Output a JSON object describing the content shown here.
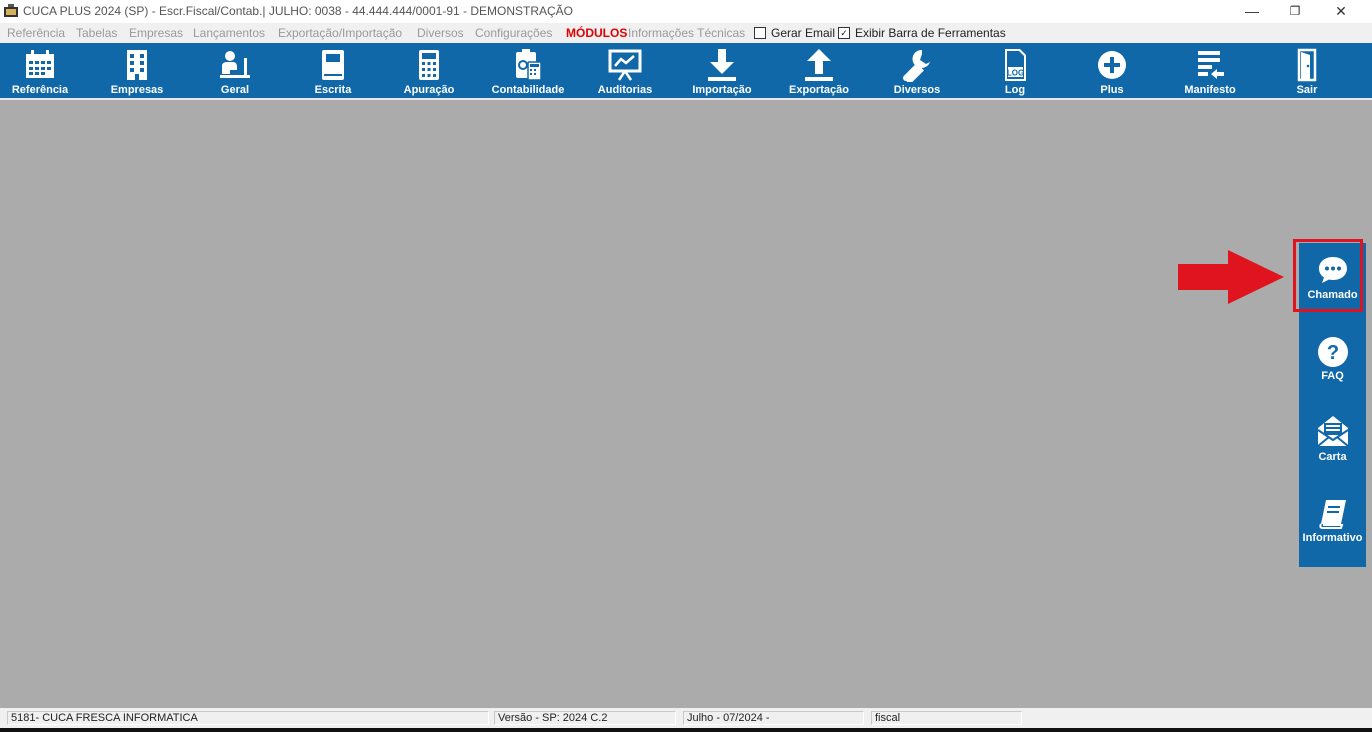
{
  "window": {
    "title": "CUCA PLUS 2024 (SP) - Escr.Fiscal/Contab.| JULHO: 0038 - 44.444.444/0001-91 - DEMONSTRAÇÃO",
    "minimize": "—",
    "restore": "❐",
    "close": "✕"
  },
  "menu": {
    "items": [
      "Referência",
      "Tabelas",
      "Empresas",
      "Lançamentos",
      "Exportação/Importação",
      "Diversos",
      "Configurações",
      "MÓDULOS",
      "Informações Técnicas"
    ],
    "gerar_email": {
      "label": "Gerar Email",
      "checked": false
    },
    "exibir_barra": {
      "label": "Exibir Barra de Ferramentas",
      "checked": true,
      "mark": "✓"
    }
  },
  "toolbar": [
    {
      "label": "Referência",
      "icon": "calendar-icon"
    },
    {
      "label": "Empresas",
      "icon": "building-icon"
    },
    {
      "label": "Geral",
      "icon": "user-desk-icon"
    },
    {
      "label": "Escrita",
      "icon": "book-icon"
    },
    {
      "label": "Apuração",
      "icon": "calculator-icon"
    },
    {
      "label": "Contabilidade",
      "icon": "accounting-icon"
    },
    {
      "label": "Auditorias",
      "icon": "chart-board-icon"
    },
    {
      "label": "Importação",
      "icon": "download-icon"
    },
    {
      "label": "Exportação",
      "icon": "upload-icon"
    },
    {
      "label": "Diversos",
      "icon": "wrench-icon"
    },
    {
      "label": "Log",
      "icon": "log-file-icon",
      "icon_text": "LOG"
    },
    {
      "label": "Plus",
      "icon": "plus-circle-icon"
    },
    {
      "label": "Manifesto",
      "icon": "manifest-icon"
    },
    {
      "label": "Sair",
      "icon": "exit-door-icon"
    }
  ],
  "side_panel": [
    {
      "label": "Chamado",
      "icon": "chat-bubble-icon"
    },
    {
      "label": "FAQ",
      "icon": "question-circle-icon",
      "icon_text": "?"
    },
    {
      "label": "Carta",
      "icon": "envelope-icon"
    },
    {
      "label": "Informativo",
      "icon": "notebook-icon"
    }
  ],
  "status": {
    "company": "5181- CUCA FRESCA INFORMATICA",
    "version": "Versão - SP: 2024 C.2",
    "period": "Julho - 07/2024 -",
    "user": "fiscal"
  },
  "colors": {
    "toolbar_bg": "#1068a8",
    "workspace_bg": "#ababab",
    "highlight": "#e0141e",
    "menu_accent": "#e00000"
  }
}
